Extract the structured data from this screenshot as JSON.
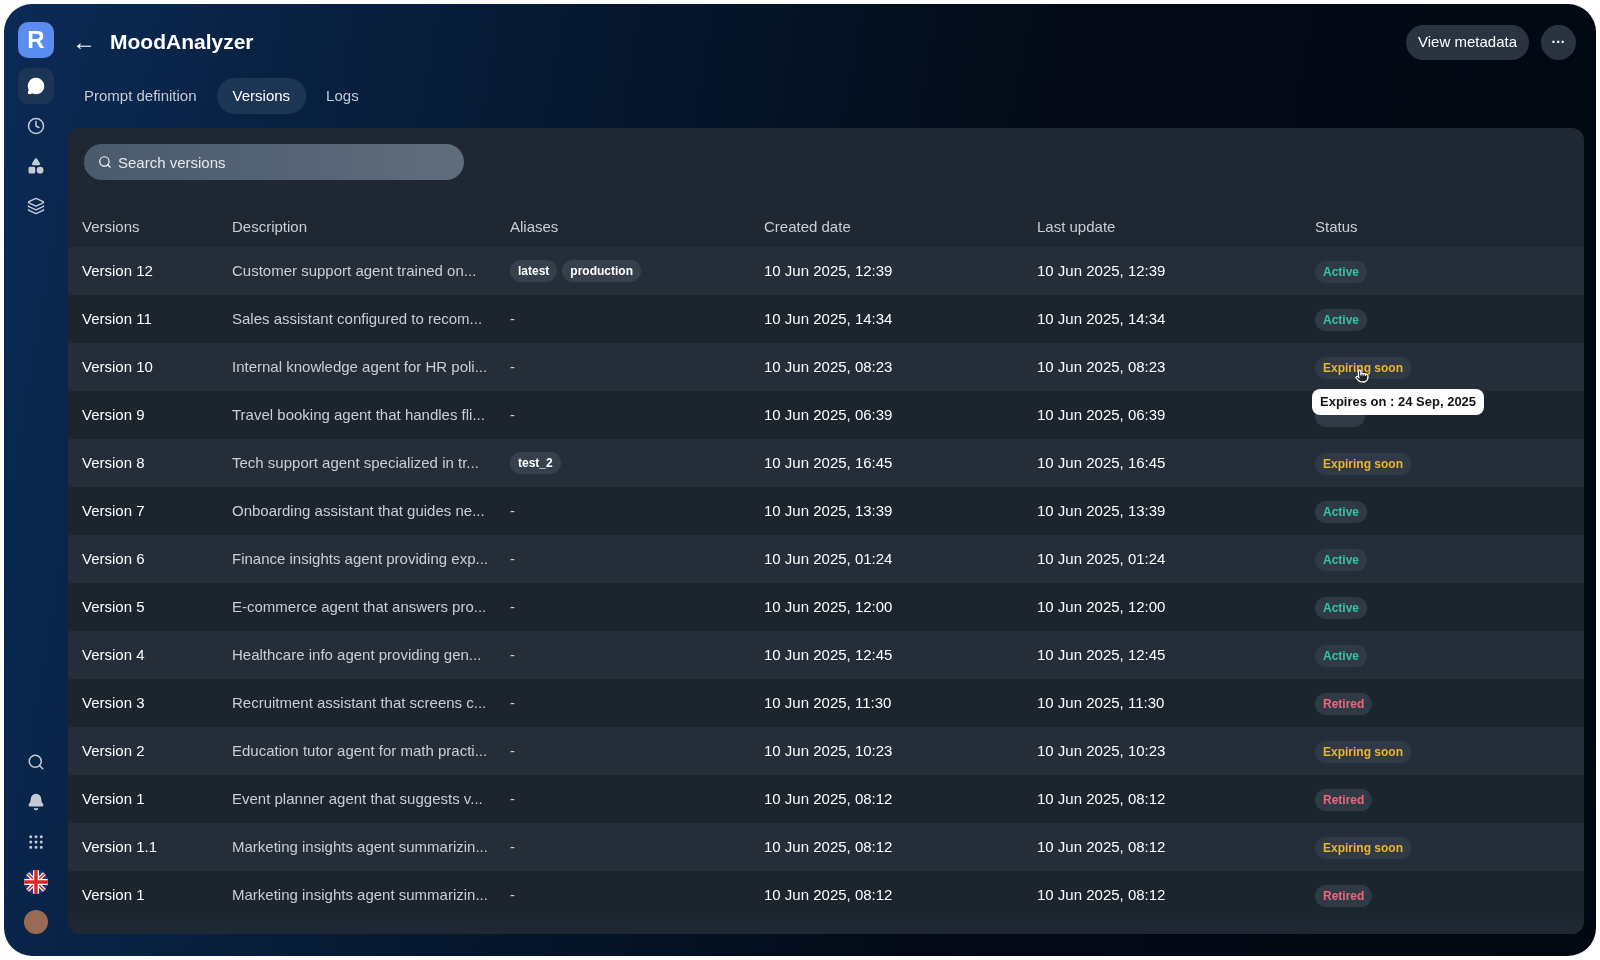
{
  "sidebar": {
    "logo": "R",
    "top_items": [
      {
        "kind": "chat",
        "selected": true
      },
      {
        "kind": "clock",
        "selected": false
      },
      {
        "kind": "shapes",
        "selected": false
      },
      {
        "kind": "layers",
        "selected": false
      }
    ],
    "bottom_items": [
      {
        "kind": "search"
      },
      {
        "kind": "bell"
      },
      {
        "kind": "apps"
      },
      {
        "kind": "flag"
      },
      {
        "kind": "avatar"
      }
    ]
  },
  "header": {
    "back": "←",
    "title": "MoodAnalyzer",
    "buttons": [
      "View metadata"
    ],
    "more": "···"
  },
  "tabs": [
    {
      "label": "Prompt definition",
      "selected": false
    },
    {
      "label": "Versions",
      "selected": true
    },
    {
      "label": "Logs",
      "selected": false
    }
  ],
  "search": {
    "placeholder": "Search versions"
  },
  "table": {
    "columns": [
      "Versions",
      "Description",
      "Aliases",
      "Created date",
      "Last update",
      "Status"
    ],
    "rows": [
      {
        "version": "Version 12",
        "description": "Customer support agent trained on...",
        "aliases": [
          "latest",
          "production"
        ],
        "created": "10 Jun 2025, 12:39",
        "updated": "10 Jun 2025, 12:39",
        "status": {
          "kind": "active",
          "label": "Active"
        }
      },
      {
        "version": "Version 11",
        "description": "Sales assistant configured to recom...",
        "aliases": "-",
        "created": "10 Jun 2025, 14:34",
        "updated": "10 Jun 2025, 14:34",
        "status": {
          "kind": "active",
          "label": "Active"
        }
      },
      {
        "version": "Version 10",
        "description": "Internal knowledge agent for HR poli...",
        "aliases": "-",
        "created": "10 Jun 2025, 08:23",
        "updated": "10 Jun 2025, 08:23",
        "status": {
          "kind": "expiring",
          "label": "Expiring soon"
        },
        "tooltip": "Expires on : 24 Sep, 2025"
      },
      {
        "version": "Version 9",
        "description": "Travel booking agent that handles fli...",
        "aliases": "-",
        "created": "10 Jun 2025, 06:39",
        "updated": "10 Jun 2025, 06:39",
        "status": {
          "kind": "active"
        }
      },
      {
        "version": "Version 8",
        "description": "Tech support agent specialized in tr...",
        "aliases": [
          "test_2"
        ],
        "created": "10 Jun 2025, 16:45",
        "updated": "10 Jun 2025, 16:45",
        "status": {
          "kind": "expiring",
          "label": "Expiring soon"
        }
      },
      {
        "version": "Version 7",
        "description": "Onboarding assistant that guides ne...",
        "aliases": "-",
        "created": "10 Jun 2025, 13:39",
        "updated": "10 Jun 2025, 13:39",
        "status": {
          "kind": "active",
          "label": "Active"
        }
      },
      {
        "version": "Version 6",
        "description": "Finance insights agent providing exp...",
        "aliases": "-",
        "created": "10 Jun 2025, 01:24",
        "updated": "10 Jun 2025, 01:24",
        "status": {
          "kind": "active",
          "label": "Active"
        }
      },
      {
        "version": "Version 5",
        "description": "E-commerce agent that answers pro...",
        "aliases": "-",
        "created": "10 Jun 2025, 12:00",
        "updated": "10 Jun 2025, 12:00",
        "status": {
          "kind": "active",
          "label": "Active"
        }
      },
      {
        "version": "Version 4",
        "description": "Healthcare info agent providing gen...",
        "aliases": "-",
        "created": "10 Jun 2025, 12:45",
        "updated": "10 Jun 2025, 12:45",
        "status": {
          "kind": "active",
          "label": "Active"
        }
      },
      {
        "version": "Version 3",
        "description": "Recruitment assistant that screens c...",
        "aliases": "-",
        "created": "10 Jun 2025, 11:30",
        "updated": "10 Jun 2025, 11:30",
        "status": {
          "kind": "retired",
          "label": "Retired"
        }
      },
      {
        "version": "Version 2",
        "description": "Education tutor agent for math practi...",
        "aliases": "-",
        "created": "10 Jun 2025, 10:23",
        "updated": "10 Jun 2025, 10:23",
        "status": {
          "kind": "expiring",
          "label": "Expiring soon"
        }
      },
      {
        "version": "Version 1",
        "description": "Event planner agent that suggests v...",
        "aliases": "-",
        "created": "10 Jun 2025, 08:12",
        "updated": "10 Jun 2025, 08:12",
        "status": {
          "kind": "retired",
          "label": "Retired"
        }
      },
      {
        "version": "Version 1.1",
        "description": "Marketing insights agent summarizin...",
        "aliases": "-",
        "created": "10 Jun 2025, 08:12",
        "updated": "10 Jun 2025, 08:12",
        "status": {
          "kind": "expiring",
          "label": "Expiring soon"
        }
      },
      {
        "version": "Version 1",
        "description": "Marketing insights agent summarizin...",
        "aliases": "-",
        "created": "10 Jun 2025, 08:12",
        "updated": "10 Jun 2025, 08:12",
        "status": {
          "kind": "retired",
          "label": "Retired"
        }
      }
    ]
  }
}
